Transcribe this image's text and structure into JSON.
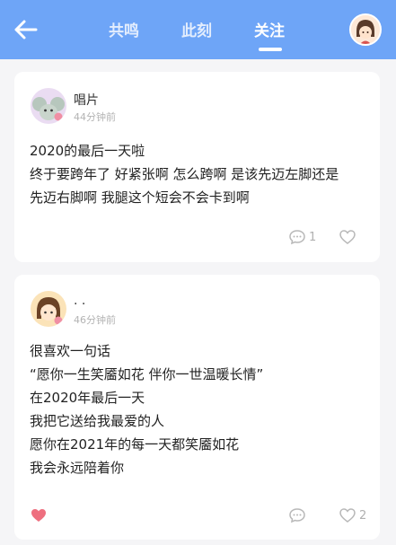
{
  "header": {
    "tabs": [
      {
        "label": "共鸣"
      },
      {
        "label": "此刻"
      },
      {
        "label": "关注"
      }
    ],
    "active_tab": "关注",
    "accent_color": "#6ea5f7"
  },
  "posts": [
    {
      "author": "唱片",
      "time": "44分钟前",
      "lines": [
        "2020的最后一天啦",
        "终于要跨年了 好紧张啊 怎么跨啊 是该先迈左脚还是",
        "先迈右脚啊 我腿这个短会不会卡到啊"
      ],
      "comment_count": "1",
      "like_count": "",
      "liked": false
    },
    {
      "author": ". .",
      "time": "46分钟前",
      "lines": [
        "很喜欢一句话",
        "“愿你一生笑靥如花 伴你一世温暖长情”",
        "在2020年最后一天",
        "我把它送给我最爱的人",
        "愿你在2021年的每一天都笑靥如花",
        "我会永远陪着你"
      ],
      "comment_count": "",
      "like_count": "2",
      "liked": true
    }
  ]
}
